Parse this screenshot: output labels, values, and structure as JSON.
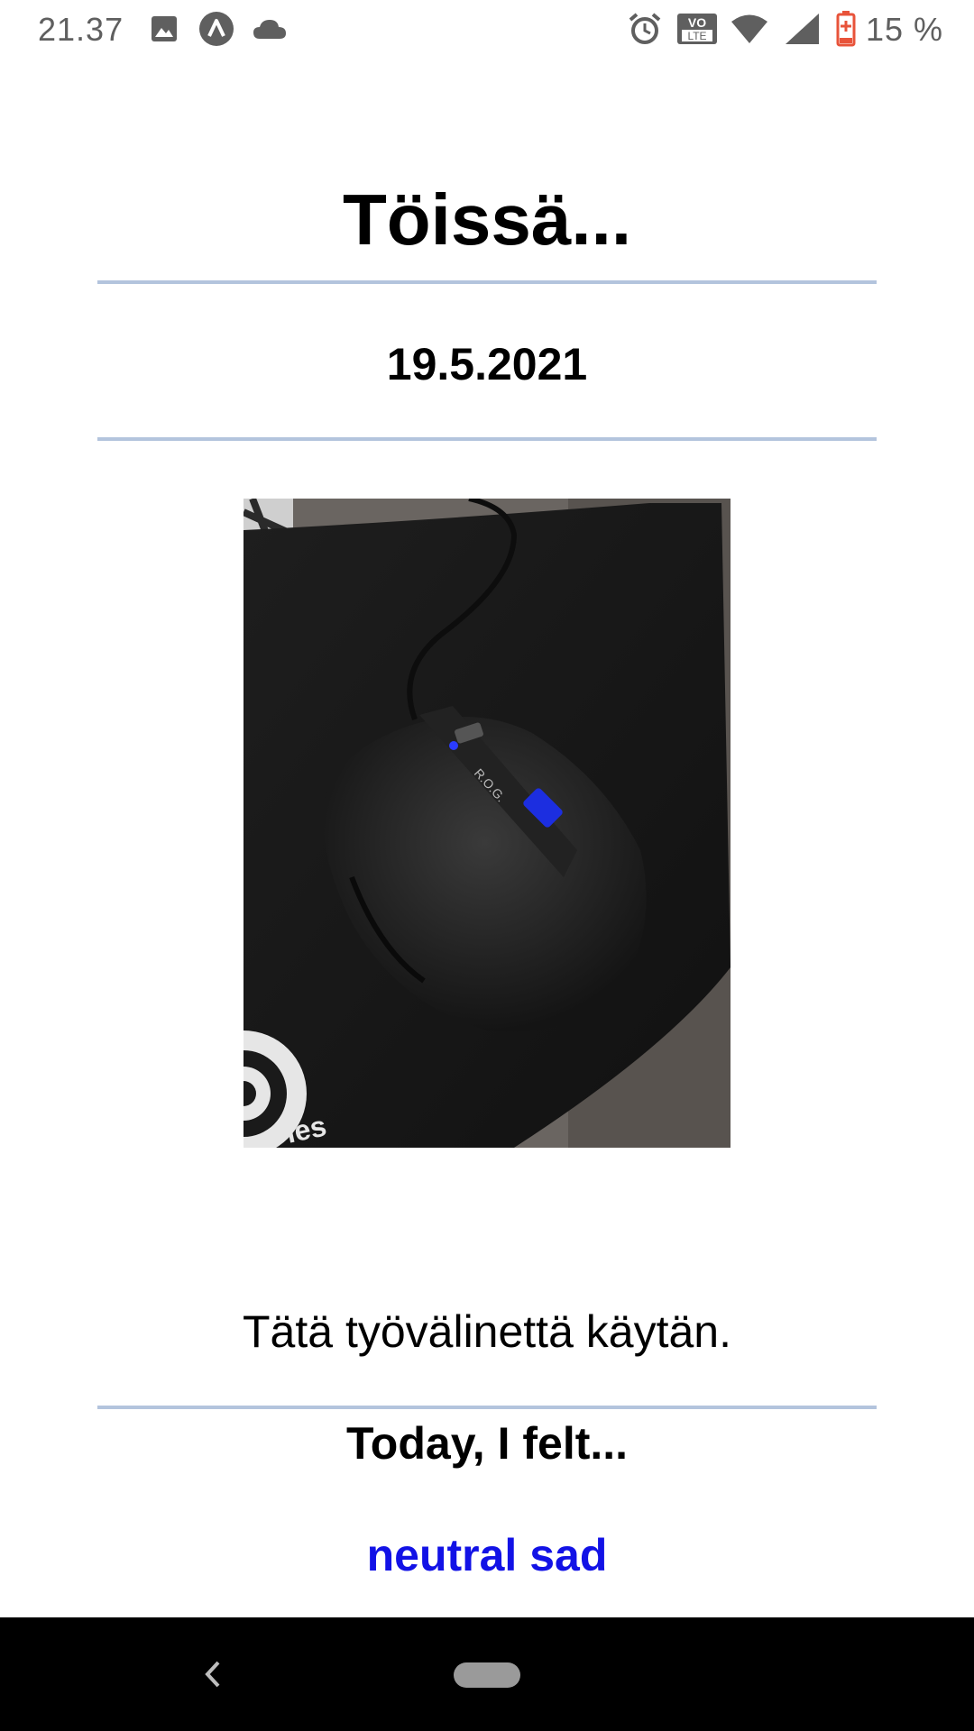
{
  "status_bar": {
    "time": "21.37",
    "battery_percent": "15 %",
    "icons": [
      "image-icon",
      "app-a-icon",
      "cloud-icon",
      "alarm-icon",
      "volte-icon",
      "wifi-icon",
      "signal-icon",
      "battery-low-icon"
    ],
    "volte_label_top": "VO",
    "volte_label_bottom": "LTE"
  },
  "entry": {
    "title": "Töissä...",
    "date": "19.5.2021",
    "caption": "Tätä työvälinettä käytän.",
    "felt_heading": "Today, I felt...",
    "mood": "neutral sad"
  },
  "colors": {
    "rule": "#b3c4dd",
    "mood_link": "#1212e6",
    "status_text": "#5f5f5f",
    "navbar": "#000000"
  },
  "nav_bar": {
    "icons": [
      "back-icon",
      "home-pill-icon"
    ]
  }
}
